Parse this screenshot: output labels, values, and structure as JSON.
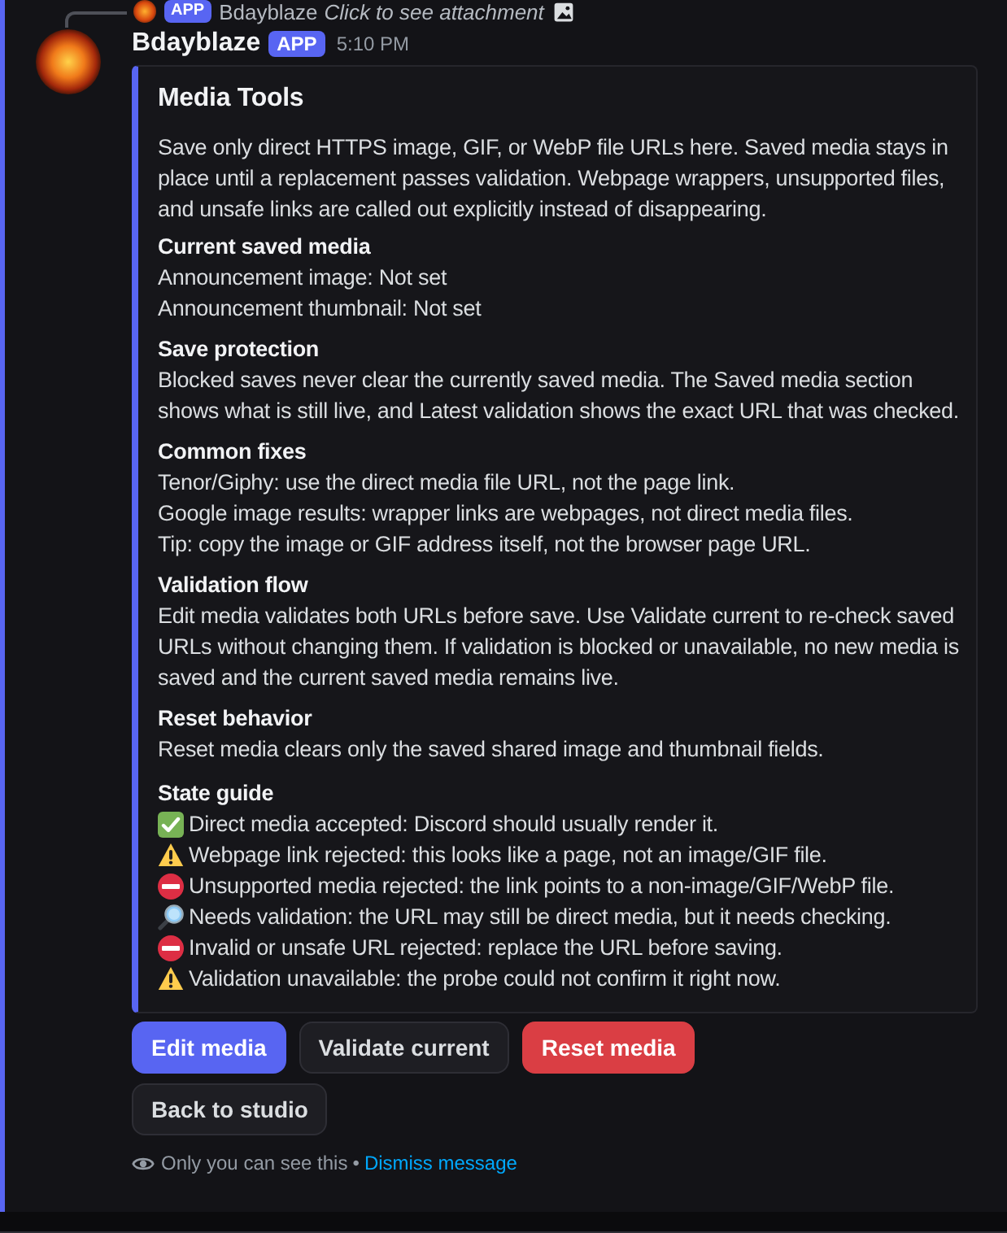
{
  "reply": {
    "badge": "APP",
    "author": "Bdayblaze",
    "text": "Click to see attachment"
  },
  "message": {
    "author": "Bdayblaze",
    "badge": "APP",
    "time": "5:10 PM"
  },
  "embed": {
    "title": "Media Tools",
    "description": "Save only direct HTTPS image, GIF, or WebP file URLs here. Saved media stays in place until a replacement passes validation. Webpage wrappers, unsupported files, and unsafe links are called out explicitly instead of disappearing.",
    "sections": [
      {
        "heading": "Current saved media",
        "lines": [
          "Announcement image: Not set",
          "Announcement thumbnail: Not set"
        ]
      },
      {
        "heading": "Save protection",
        "lines": [
          "Blocked saves never clear the currently saved media. The Saved media section shows what is still live, and Latest validation shows the exact URL that was checked."
        ]
      },
      {
        "heading": "Common fixes",
        "lines": [
          "Tenor/Giphy: use the direct media file URL, not the page link.",
          "Google image results: wrapper links are webpages, not direct media files.",
          "Tip: copy the image or GIF address itself, not the browser page URL."
        ]
      },
      {
        "heading": "Validation flow",
        "lines": [
          "Edit media validates both URLs before save. Use Validate current to re-check saved URLs without changing them. If validation is blocked or unavailable, no new media is saved and the current saved media remains live."
        ]
      },
      {
        "heading": "Reset behavior",
        "lines": [
          "Reset media clears only the saved shared image and thumbnail fields."
        ]
      }
    ],
    "state_guide": {
      "heading": "State guide",
      "items": [
        {
          "kind": "check",
          "text": "Direct media accepted: Discord should usually render it."
        },
        {
          "kind": "warning",
          "text": "Webpage link rejected: this looks like a page, not an image/GIF file."
        },
        {
          "kind": "no_entry",
          "text": "Unsupported media rejected: the link points to a non-image/GIF/WebP file."
        },
        {
          "kind": "magnifier",
          "text": "Needs validation: the URL may still be direct media, but it needs checking."
        },
        {
          "kind": "no_entry",
          "text": "Invalid or unsafe URL rejected: replace the URL before saving."
        },
        {
          "kind": "warning",
          "text": "Validation unavailable: the probe could not confirm it right now."
        }
      ]
    }
  },
  "button_rows": [
    [
      {
        "label": "Edit media",
        "kind": "primary"
      },
      {
        "label": "Validate current",
        "kind": "secondary"
      },
      {
        "label": "Reset media",
        "kind": "danger"
      }
    ],
    [
      {
        "label": "Back to studio",
        "kind": "secondary"
      }
    ]
  ],
  "footer": {
    "note": "Only you can see this",
    "separator": "•",
    "link": "Dismiss message"
  }
}
